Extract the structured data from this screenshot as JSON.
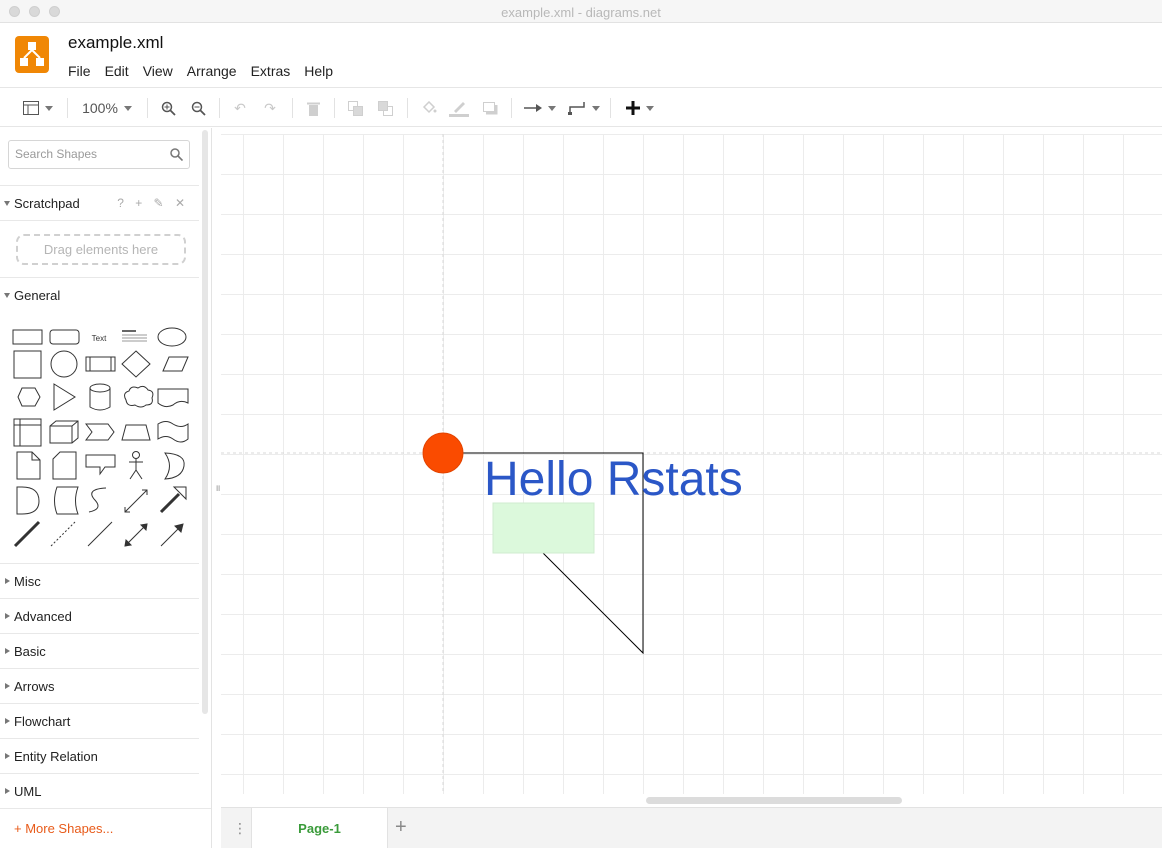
{
  "window": {
    "title": "example.xml - diagrams.net"
  },
  "header": {
    "file_name": "example.xml",
    "menu": [
      "File",
      "Edit",
      "View",
      "Arrange",
      "Extras",
      "Help"
    ]
  },
  "toolbar": {
    "zoom": "100%"
  },
  "sidebar": {
    "search_placeholder": "Search Shapes",
    "scratchpad": {
      "title": "Scratchpad",
      "tools": "? + ✎ ✕",
      "drop_hint": "Drag elements here"
    },
    "general_title": "General",
    "text_shape_label": "Text",
    "collapsed_sections": [
      "Misc",
      "Advanced",
      "Basic",
      "Arrows",
      "Flowchart",
      "Entity Relation",
      "UML"
    ],
    "more_shapes": "+ More Shapes..."
  },
  "canvas": {
    "text": "Hello Rstats"
  },
  "pages": {
    "current": "Page-1"
  },
  "colors": {
    "accent_orange": "#f08705",
    "circle": "#fa4b00",
    "text_blue": "#2b57c7",
    "green_fill": "#dcf9dc",
    "page_tab_green": "#3a9b3a"
  }
}
